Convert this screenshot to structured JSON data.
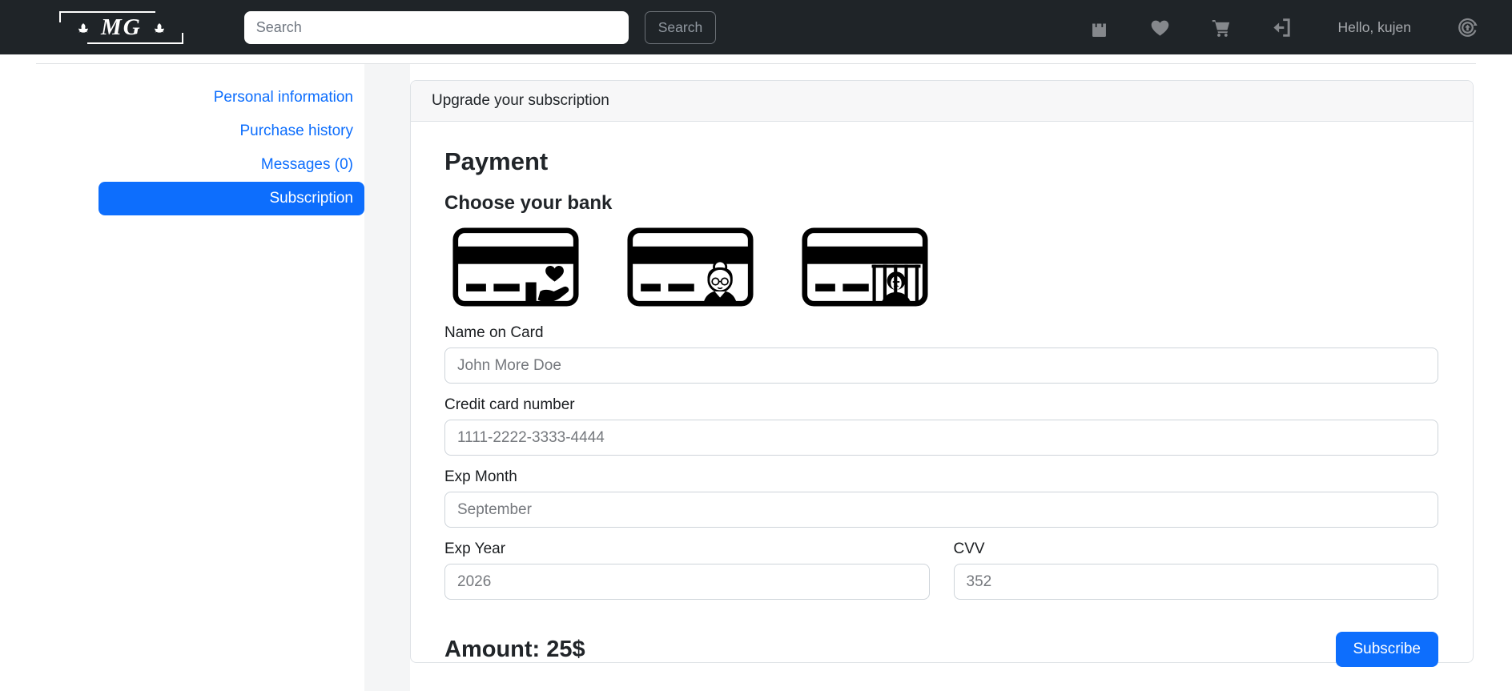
{
  "navbar": {
    "logo_text": "MG",
    "logo_icons": [
      "flower-icon",
      "flower-icon"
    ],
    "search": {
      "placeholder": "Search",
      "button_label": "Search"
    },
    "icons": [
      "bag-icon",
      "heart-icon",
      "cart-icon",
      "sign-out-icon",
      "sync-icon"
    ],
    "greeting": "Hello, kujen"
  },
  "sidebar": {
    "items": [
      {
        "label": "Personal information",
        "active": false
      },
      {
        "label": "Purchase history",
        "active": false
      },
      {
        "label": "Messages (0)",
        "active": false
      },
      {
        "label": "Subscription",
        "active": true
      }
    ]
  },
  "main": {
    "card_header": "Upgrade your subscription",
    "title": "Payment",
    "bank_section_title": "Choose your bank",
    "bank_icons": [
      "hand-heart-card-icon",
      "grandma-card-icon",
      "prisoner-behind-bars-card-icon"
    ],
    "fields": {
      "name": {
        "label": "Name on Card",
        "placeholder": "John More Doe"
      },
      "card_number": {
        "label": "Credit card number",
        "placeholder": "1111-2222-3333-4444"
      },
      "exp_month": {
        "label": "Exp Month",
        "placeholder": "September"
      },
      "exp_year": {
        "label": "Exp Year",
        "placeholder": "2026"
      },
      "cvv": {
        "label": "CVV",
        "placeholder": "352"
      }
    },
    "amount_label": "Amount: 25$",
    "subscribe_label": "Subscribe"
  },
  "colors": {
    "accent": "#0d6efd",
    "navbar_bg": "#1f2428",
    "nav_icon_gray": "#85888c",
    "card_border": "#dee2e6",
    "gutter_gray": "#f4f5f6"
  }
}
